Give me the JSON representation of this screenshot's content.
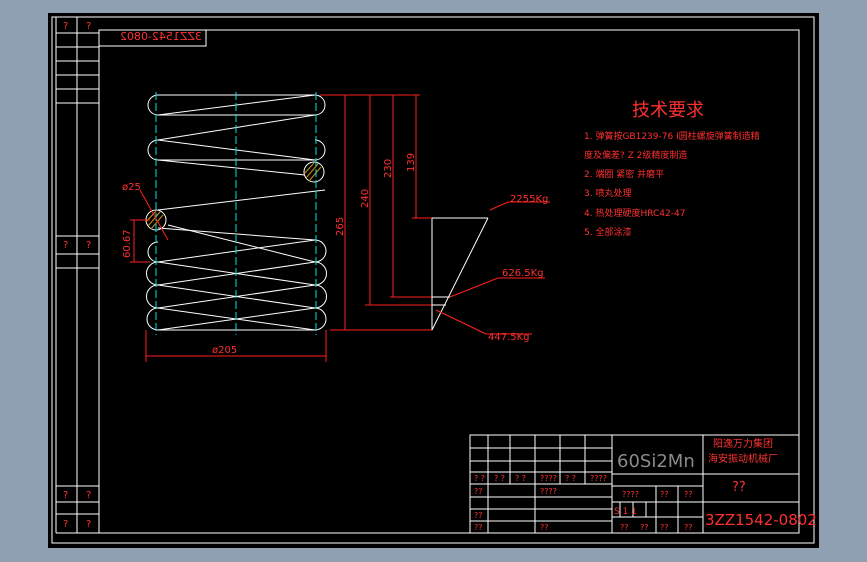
{
  "drawing": {
    "part_number_mirrored": "3ZZ1542-0802",
    "part_number": "3ZZ1542-0802",
    "material": "60Si2Mn",
    "company_line1": "阳逸万力集团",
    "company_line2": "海安振动机械厂",
    "drawing_name": "??",
    "scale_cell": "S  1  1",
    "qmark_2": "? ?",
    "qmark_single": "?",
    "qmark_4": "????",
    "qmark_2b": "??"
  },
  "tech_requirements": {
    "title": "技术要求",
    "items": [
      "1. 弹簧按GB1239-76 I圆柱螺旋弹簧制造精",
      "度及偏差? Z 2级精度制造",
      "2. 端圈 紧密 并磨平",
      "3. 喷丸处理",
      "4. 热处理硬度HRC42-47",
      "5. 全部涂漆"
    ]
  },
  "dimensions": {
    "wire_diameter": "ø25",
    "pitch": "60.67",
    "outer_diameter": "ø205",
    "h1": "265",
    "h2": "240",
    "h3": "230",
    "h4": "139"
  },
  "loads": {
    "load_high": "2255Kg",
    "load_mid": "626.5Kg",
    "load_low": "447.5Kg"
  },
  "colors": {
    "frame_bg": "#000000",
    "outline": "#ffffff",
    "annotation": "#ff2020",
    "centerline": "#00e0e0",
    "hatch": "#c8901a",
    "window_bg": "#8fa0b3"
  }
}
